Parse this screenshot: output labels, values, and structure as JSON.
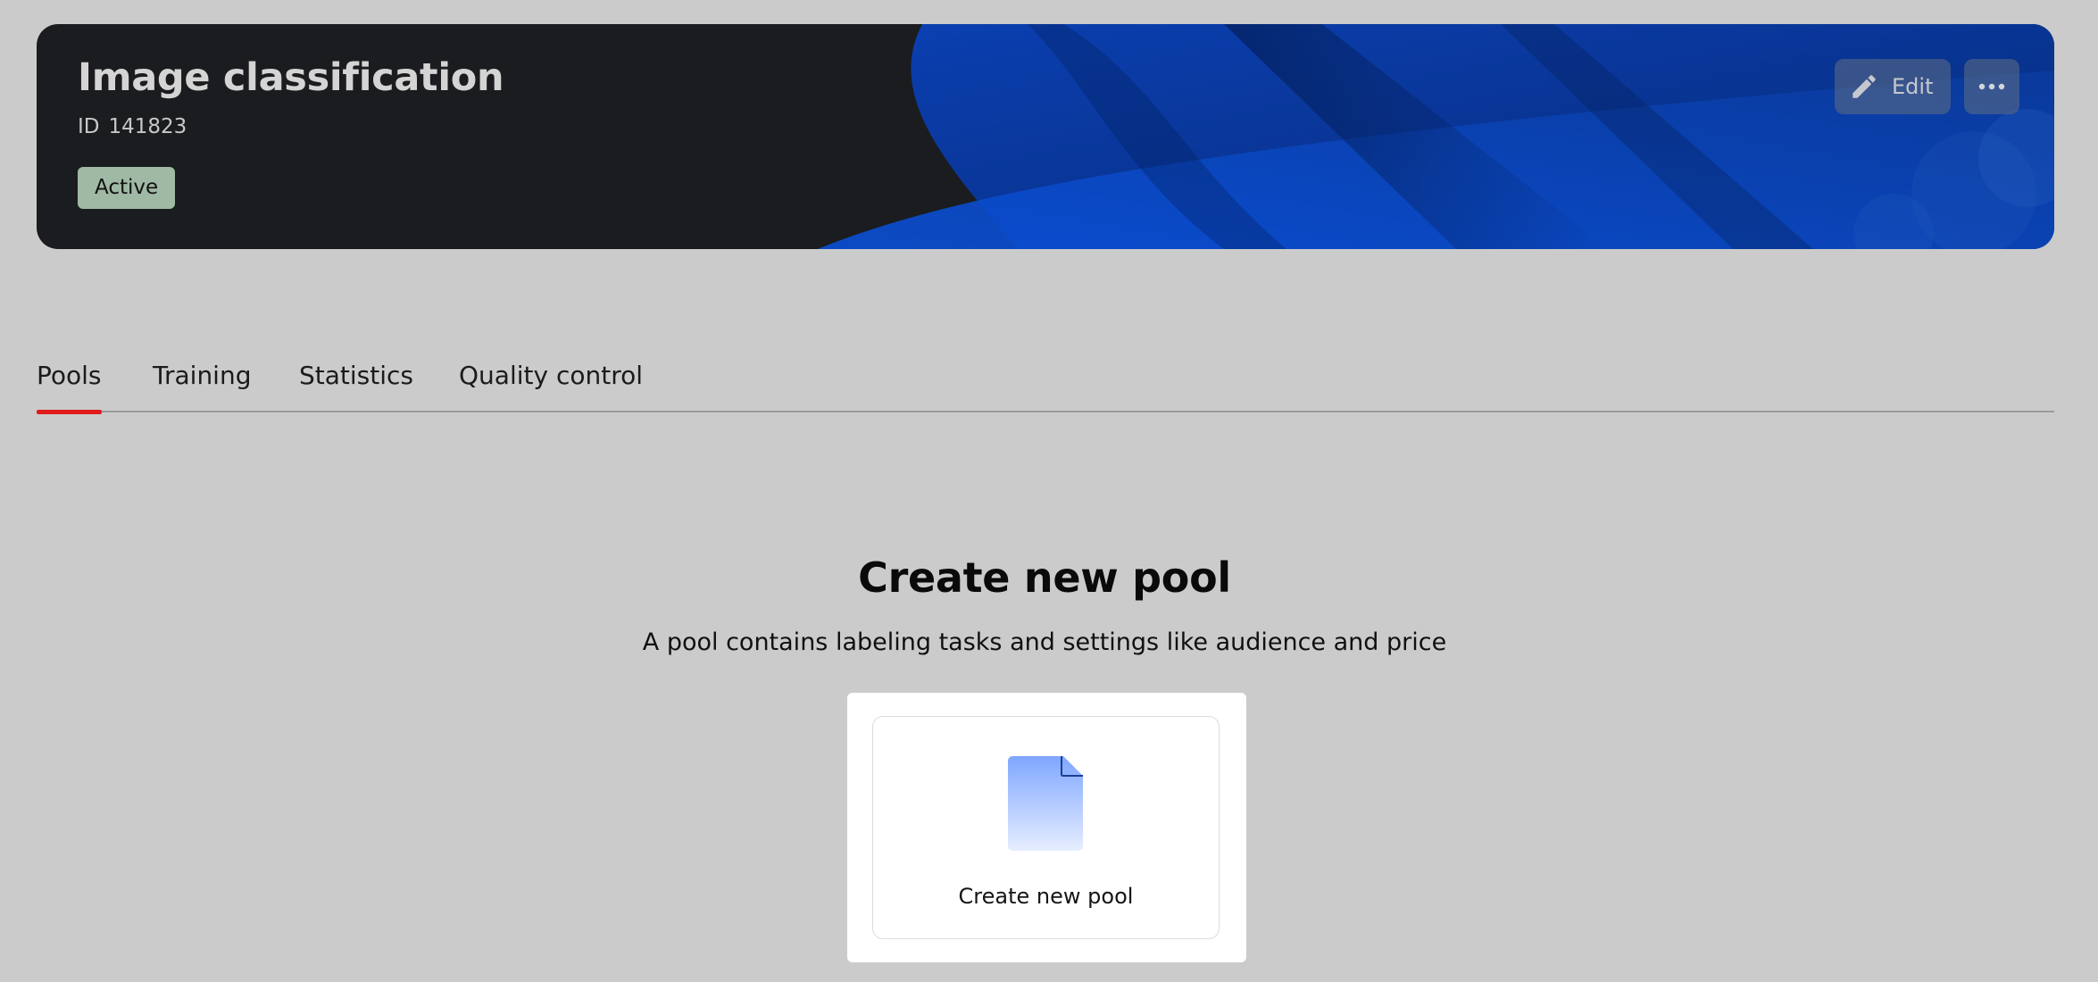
{
  "project": {
    "title": "Image classification",
    "id_label": "ID",
    "id_value": "141823",
    "status": "Active",
    "edit_label": "Edit"
  },
  "tabs": [
    {
      "label": "Pools",
      "active": true
    },
    {
      "label": "Training",
      "active": false
    },
    {
      "label": "Statistics",
      "active": false
    },
    {
      "label": "Quality control",
      "active": false
    }
  ],
  "empty_state": {
    "title": "Create new pool",
    "subtitle": "A pool contains labeling tasks and settings like audience and price",
    "card_label": "Create new pool"
  },
  "colors": {
    "page_background": "#cbcbcb",
    "hero_background": "#1b1c1f",
    "hero_accent": "#0a44b8",
    "status_badge": "#9fb9a5",
    "active_tab_underline": "#e11b1b",
    "doc_icon_top": "#7fa6ff",
    "doc_icon_bottom": "#e6eeff"
  },
  "icons": {
    "edit": "pencil-icon",
    "more": "more-horizontal-icon",
    "create_card": "document-icon"
  }
}
